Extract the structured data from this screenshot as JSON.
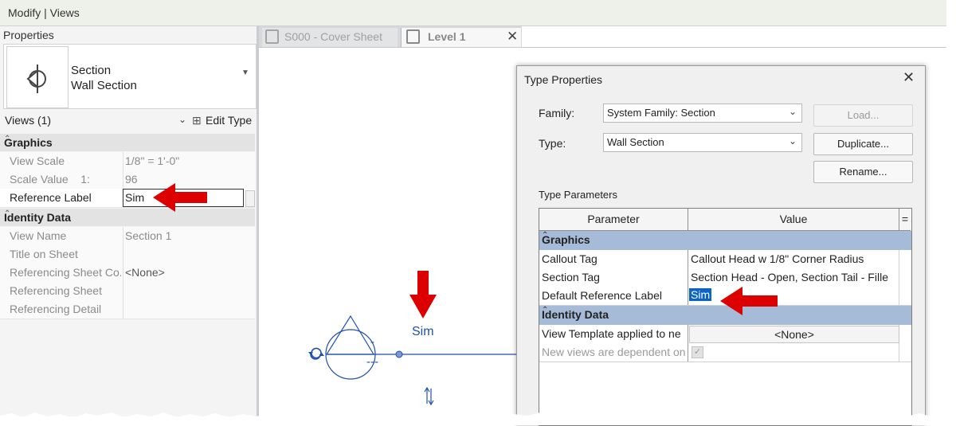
{
  "window": {
    "title": "Modify | Views"
  },
  "properties": {
    "header": "Properties",
    "type_name": "Section",
    "type_sub": "Wall Section",
    "filter": "Views (1)",
    "edit_type": "Edit Type",
    "graphics_label": "Graphics",
    "graphics_rows": [
      {
        "label": "View Scale",
        "value": "1/8\" = 1'-0\""
      },
      {
        "label": "Scale Value    1:",
        "value": "96"
      }
    ],
    "reference_label": {
      "label": "Reference Label",
      "value": "Sim"
    },
    "identity_label": "Identity Data",
    "identity_rows": [
      {
        "label": "View Name",
        "value": "Section 1"
      },
      {
        "label": "Title on Sheet",
        "value": ""
      },
      {
        "label": "Referencing Sheet Co...",
        "value": "<None>"
      },
      {
        "label": "Referencing Sheet",
        "value": ""
      },
      {
        "label": "Referencing Detail",
        "value": ""
      }
    ]
  },
  "tabs": [
    {
      "label": "S000 - Cover Sheet"
    },
    {
      "label": "Level 1"
    }
  ],
  "canvas": {
    "section_label": "Sim",
    "head_top": "-",
    "head_bottom": "---"
  },
  "dialog": {
    "title": "Type Properties",
    "family_label": "Family:",
    "family_value": "System Family: Section",
    "type_label": "Type:",
    "type_value": "Wall Section",
    "load_button": "Load...",
    "duplicate_button": "Duplicate...",
    "rename_button": "Rename...",
    "type_parameters": "Type Parameters",
    "col_parameter": "Parameter",
    "col_value": "Value",
    "col_eq": "=",
    "graphics_label": "Graphics",
    "graphics_rows": [
      {
        "param": "Callout Tag",
        "value": "Callout Head w 1/8\" Corner Radius"
      },
      {
        "param": "Section Tag",
        "value": "Section Head - Open, Section Tail - Fille"
      },
      {
        "param": "Default Reference Label",
        "value": "Sim"
      }
    ],
    "identity_label": "Identity Data",
    "identity_rows": [
      {
        "param": "View Template applied to ne",
        "value": "<None>"
      },
      {
        "param": "New views are dependent on",
        "value": ""
      }
    ]
  },
  "colors": {
    "accent_red": "#dd0000",
    "selection_blue": "#0a64c8",
    "section_line": "#1f4fb0"
  }
}
